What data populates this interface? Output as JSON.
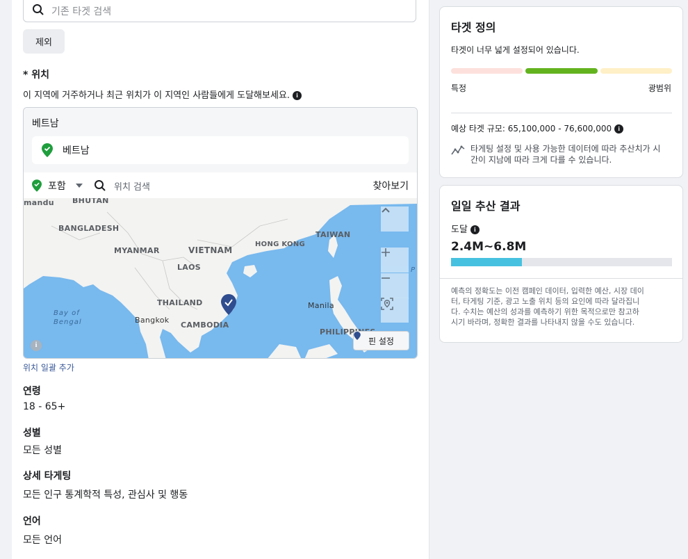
{
  "audience": {
    "existing_search_placeholder": "기존 타겟 검색",
    "exclude_button": "제외",
    "location_label": "* 위치",
    "location_description": "이 지역에 거주하거나 최근 위치가 이 지역인 사람들에게 도달해보세요.",
    "country_group": "베트남",
    "selected_location": "베트남",
    "include_label": "포함",
    "location_search_placeholder": "위치 검색",
    "browse_label": "찾아보기",
    "map_labels": {
      "mandu": "mandu",
      "bhutan": "BHUTAN",
      "bangladesh": "BANGLADESH",
      "myanmar": "MYANMAR",
      "vietnam": "VIETNAM",
      "hongkong": "HONG KONG",
      "taiwan": "TAIWAN",
      "laos": "LAOS",
      "thailand": "THAILAND",
      "bay_of_bengal_1": "Bay of",
      "bay_of_bengal_2": "Bengal",
      "bangkok": "Bangkok",
      "cambodia": "CAMBODIA",
      "manila": "Manila",
      "philippines": "PHILIPPINES",
      "edge_p": "P"
    },
    "pin_set_label": "핀 설정",
    "add_bulk_locations": "위치 일괄 추가",
    "age_label": "연령",
    "age_value": "18 - 65+",
    "gender_label": "성별",
    "gender_value": "모든 성별",
    "detailed_targeting_label": "상세 타게팅",
    "detailed_targeting_value": "모든 인구 통계학적 특성, 관심사 및 행동",
    "language_label": "언어",
    "language_value": "모든 언어"
  },
  "definition": {
    "title": "타겟 정의",
    "status": "타겟이 너무 넓게 설정되어 있습니다.",
    "specific_label": "특정",
    "broad_label": "광범위",
    "size_label": "예상 타겟 규모: 65,100,000 - 76,600,000",
    "note": "타게팅 설정 및 사용 가능한 데이터에 따라 추산치가 시간이 지남에 따라 크게 다를 수 있습니다.",
    "note_line1": "타게팅 설정 및 사용 가능한 데이터에 따라 추산치가 시",
    "note_line2": "간이 지남에 따라 크게 다를 수 있습니다."
  },
  "daily": {
    "title": "일일 추산 결과",
    "reach_label": "도달",
    "reach_value": "2.4M~6.8M",
    "reach_bar_fraction": 0.32,
    "disclaimer_line1": "예측의 정확도는 이전 캠페인 데이터, 입력한 예산, 시장 데이",
    "disclaimer_line2": "터, 타게팅 기준, 광고 노출 위치 등의 요인에 따라 달라집니",
    "disclaimer_line3": "다. 수치는 예산의 성과를 예측하기 위한 목적으로만 참고하",
    "disclaimer_line4": "시기 바라며, 정확한 결과를 나타내지 않을 수도 있습니다."
  },
  "colors": {
    "meter_left": "#fde0dc",
    "meter_active": "#63b31f",
    "meter_right": "#fff0c7",
    "reach_bar": "#47c1e0",
    "link": "#385898",
    "pin_green": "#1f9e3d",
    "map_pin": "#2f4d8f"
  }
}
